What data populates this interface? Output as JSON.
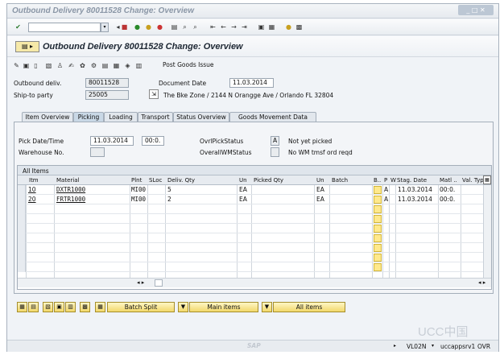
{
  "window": {
    "title": "Outbound Delivery 80011528 Change: Overview",
    "controls": "_ □ ✕"
  },
  "std_toolbar": {
    "command_field": "",
    "icons": [
      "enter-icon",
      "save-icon",
      "back-icon",
      "exit-icon",
      "cancel-icon",
      "print-icon",
      "find-icon",
      "find-next-icon",
      "first-page-icon",
      "prev-page-icon",
      "next-page-icon",
      "last-page-icon",
      "new-session-icon",
      "shortcut-icon",
      "help-icon",
      "customize-icon"
    ]
  },
  "screen": {
    "title": "Outbound Delivery 80011528 Change: Overview"
  },
  "app_toolbar": {
    "post_goods_issue_label": "Post Goods Issue"
  },
  "header": {
    "outbound_deliv_label": "Outbound deliv.",
    "outbound_deliv_value": "80011528",
    "document_date_label": "Document Date",
    "document_date_value": "11.03.2014",
    "ship_to_label": "Ship-to party",
    "ship_to_value": "25005",
    "ship_to_address": "The Bke Zone / 2144 N Orangge Ave / Orlando FL 32804"
  },
  "tabs": [
    {
      "label": "Item Overview",
      "active": false
    },
    {
      "label": "Picking",
      "active": true
    },
    {
      "label": "Loading",
      "active": false
    },
    {
      "label": "Transport",
      "active": false
    },
    {
      "label": "Status Overview",
      "active": false
    },
    {
      "label": "Goods Movement Data",
      "active": false
    }
  ],
  "picking": {
    "pick_date_label": "Pick Date/Time",
    "pick_date_value": "11.03.2014",
    "pick_time_value": "00:0.",
    "warehouse_label": "Warehouse No.",
    "warehouse_value": "",
    "ovrl_pick_status_label": "OvrlPickStatus",
    "ovrl_pick_status_value": "A",
    "ovrl_pick_status_text": "Not yet picked",
    "overall_wm_label": "OverallWMStatus",
    "overall_wm_value": "",
    "overall_wm_text": "No WM tmsf ord reqd"
  },
  "items_table": {
    "title": "All Items",
    "columns": [
      "Itm",
      "Material",
      "Plnt",
      "SLoc",
      "Deliv. Qty",
      "Un",
      "Picked Qty",
      "Un",
      "Batch",
      "B..",
      "P",
      "W",
      "Stag. Date",
      "Matl ..",
      "Val. Type"
    ],
    "rows": [
      {
        "itm": "10",
        "material": "DXTR1000",
        "plnt": "MI00",
        "sloc": "",
        "deliv_qty": "5",
        "un": "EA",
        "picked_qty": "",
        "un2": "EA",
        "batch": "",
        "p": "A",
        "stag_date": "11.03.2014",
        "matl": "00:0."
      },
      {
        "itm": "20",
        "material": "FRTR1000",
        "plnt": "MI00",
        "sloc": "",
        "deliv_qty": "2",
        "un": "EA",
        "picked_qty": "",
        "un2": "EA",
        "batch": "",
        "p": "A",
        "stag_date": "11.03.2014",
        "matl": "00:0."
      }
    ]
  },
  "bottom_buttons": {
    "batch_split": "Batch Split",
    "main_items": "Main items",
    "all_items": "All items"
  },
  "statusbar": {
    "sap_logo": "SAP",
    "transaction": "VL02N",
    "server": "uccappsrv1",
    "mode": "OVR",
    "watermark": "UCC中国"
  }
}
